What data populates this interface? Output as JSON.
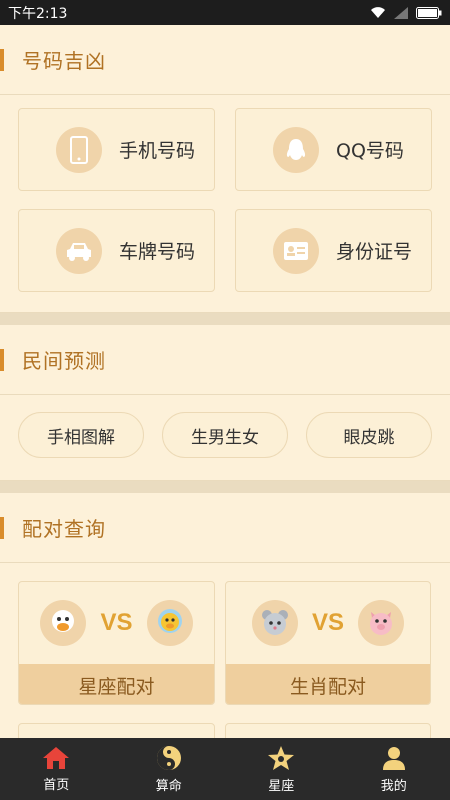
{
  "status_bar": {
    "time": "下午2:13"
  },
  "sections": {
    "numbers": {
      "title": "号码吉凶",
      "items": [
        {
          "label": "手机号码",
          "icon": "phone-icon"
        },
        {
          "label": "QQ号码",
          "icon": "qq-icon"
        },
        {
          "label": "车牌号码",
          "icon": "car-icon"
        },
        {
          "label": "身份证号",
          "icon": "id-card-icon"
        }
      ]
    },
    "folk": {
      "title": "民间预测",
      "items": [
        {
          "label": "手相图解"
        },
        {
          "label": "生男生女"
        },
        {
          "label": "眼皮跳"
        }
      ]
    },
    "pairing": {
      "title": "配对查询",
      "vs_text": "VS",
      "items": [
        {
          "label": "星座配对"
        },
        {
          "label": "生肖配对"
        }
      ]
    }
  },
  "tabbar": {
    "items": [
      {
        "label": "首页",
        "icon": "home-icon",
        "color": "#e8443a"
      },
      {
        "label": "算命",
        "icon": "yin-yang-icon",
        "color": "#f3d27d"
      },
      {
        "label": "星座",
        "icon": "star-icon",
        "color": "#f3d27d"
      },
      {
        "label": "我的",
        "icon": "user-icon",
        "color": "#f3d27d"
      }
    ]
  }
}
